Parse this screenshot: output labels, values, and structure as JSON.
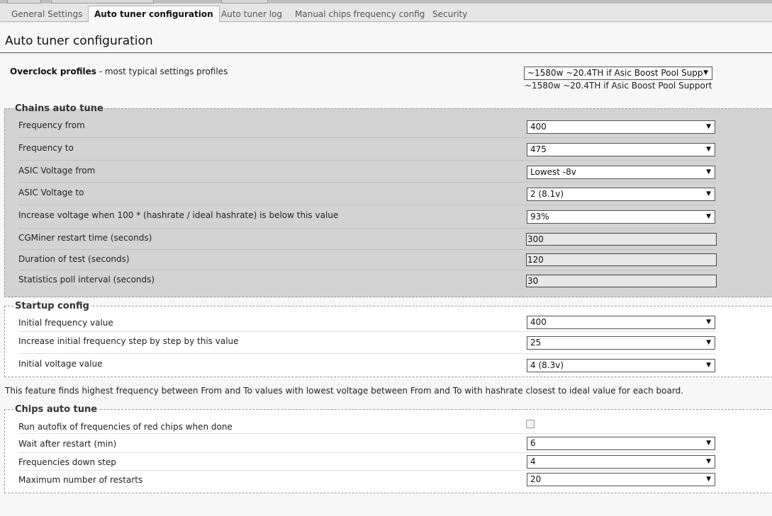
{
  "tabs": [
    {
      "label": "General Settings"
    },
    {
      "label": "Auto tuner configuration"
    },
    {
      "label": "Auto tuner log"
    },
    {
      "label": "Manual chips frequency config"
    },
    {
      "label": "Security"
    }
  ],
  "page": {
    "title": "Auto tuner configuration"
  },
  "overclock": {
    "label": "Overclock profiles",
    "description": " - most typical settings profiles",
    "selected": "~1580w ~20.4TH if Asic Boost Pool Supp",
    "summary": "~1580w ~20.4TH if Asic Boost Pool Support"
  },
  "chains": {
    "legend": "Chains auto tune",
    "frequency_from": {
      "label": "Frequency from",
      "value": "400"
    },
    "frequency_to": {
      "label": "Frequency to",
      "value": "475"
    },
    "voltage_from": {
      "label": "ASIC Voltage from",
      "value": "Lowest -8v"
    },
    "voltage_to": {
      "label": "ASIC Voltage to",
      "value": "2 (8.1v)"
    },
    "increase_voltage": {
      "label": "Increase voltage when 100 * (hashrate / ideal hashrate) is below this value",
      "value": "93%"
    },
    "restart_time": {
      "label": "CGMiner restart time (seconds)",
      "value": "300"
    },
    "test_duration": {
      "label": "Duration of test (seconds)",
      "value": "120"
    },
    "poll_interval": {
      "label": "Statistics poll interval (seconds)",
      "value": "30"
    }
  },
  "startup": {
    "legend": "Startup config",
    "initial_frequency": {
      "label": "Initial frequency value",
      "value": "400"
    },
    "frequency_step": {
      "label": "Increase initial frequency step by step by this value",
      "value": "25"
    },
    "initial_voltage": {
      "label": "Initial voltage value",
      "value": "4 (8.3v)"
    }
  },
  "info_text": "This feature finds highest frequency between From and To values with lowest voltage between From and To with hashrate closest to ideal value for each board.",
  "chips": {
    "legend": "Chips auto tune",
    "autofix": {
      "label": "Run autofix of frequencies of red chips when done",
      "checked": false
    },
    "wait_after_restart": {
      "label": "Wait after restart (min)",
      "value": "6"
    },
    "down_step": {
      "label": "Frequencies down step",
      "value": "4"
    },
    "max_restarts": {
      "label": "Maximum number of restarts",
      "value": "20"
    }
  },
  "icons": {
    "dropdown": "chevron-down-icon",
    "checkbox": "checkbox-icon"
  }
}
